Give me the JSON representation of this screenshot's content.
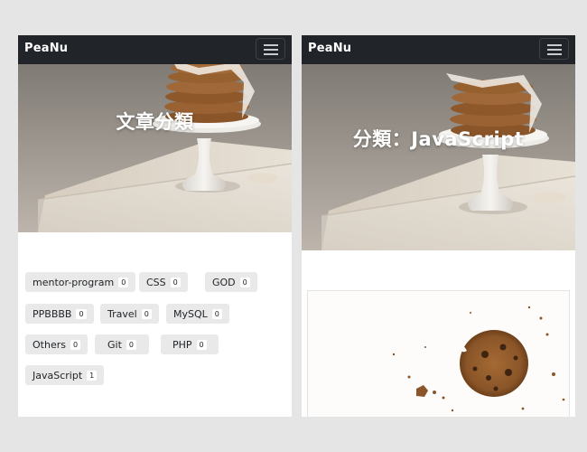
{
  "left_panel": {
    "brand": "PeaNu",
    "menu_icon": "hamburger-menu-icon",
    "hero_title": "文章分類",
    "tags": [
      {
        "name": "mentor-program",
        "count": "0"
      },
      {
        "name": "CSS",
        "count": "0"
      },
      {
        "name": "GOD",
        "count": "0"
      },
      {
        "name": "PPBBBB",
        "count": "0"
      },
      {
        "name": "Travel",
        "count": "0"
      },
      {
        "name": "MySQL",
        "count": "0"
      },
      {
        "name": "Others",
        "count": "0"
      },
      {
        "name": "Git",
        "count": "0"
      },
      {
        "name": "PHP",
        "count": "0"
      },
      {
        "name": "JavaScript",
        "count": "1"
      }
    ]
  },
  "right_panel": {
    "brand": "PeaNu",
    "menu_icon": "hamburger-menu-icon",
    "hero_title": "分類：JavaScript"
  },
  "colors": {
    "navbar": "#212529",
    "tag_background": "#e9e9e9",
    "page_background": "#e5e5e5"
  }
}
